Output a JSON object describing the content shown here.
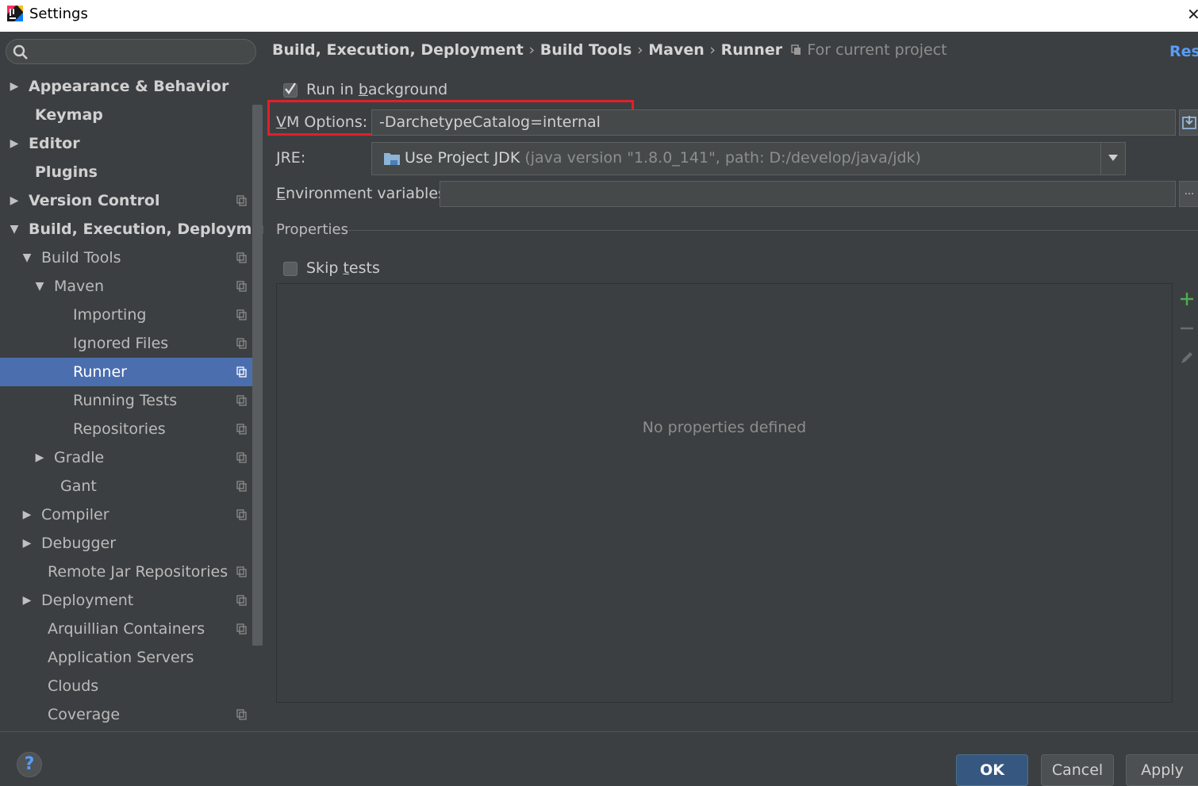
{
  "window": {
    "title": "Settings"
  },
  "search": {
    "placeholder": ""
  },
  "sidebar": {
    "items": [
      {
        "label": "Appearance & Behavior",
        "arrow": "▶",
        "bold": true
      },
      {
        "label": "Keymap",
        "arrow": "",
        "bold": true
      },
      {
        "label": "Editor",
        "arrow": "▶",
        "bold": true
      },
      {
        "label": "Plugins",
        "arrow": "",
        "bold": true
      },
      {
        "label": "Version Control",
        "arrow": "▶",
        "bold": true
      },
      {
        "label": "Build, Execution, Deployment",
        "arrow": "▼",
        "bold": true
      },
      {
        "label": "Build Tools",
        "arrow": "▼"
      },
      {
        "label": "Maven",
        "arrow": "▼"
      },
      {
        "label": "Importing",
        "arrow": ""
      },
      {
        "label": "Ignored Files",
        "arrow": ""
      },
      {
        "label": "Runner",
        "arrow": "",
        "selected": true
      },
      {
        "label": "Running Tests",
        "arrow": ""
      },
      {
        "label": "Repositories",
        "arrow": ""
      },
      {
        "label": "Gradle",
        "arrow": "▶"
      },
      {
        "label": "Gant",
        "arrow": ""
      },
      {
        "label": "Compiler",
        "arrow": "▶"
      },
      {
        "label": "Debugger",
        "arrow": "▶"
      },
      {
        "label": "Remote Jar Repositories",
        "arrow": ""
      },
      {
        "label": "Deployment",
        "arrow": "▶"
      },
      {
        "label": "Arquillian Containers",
        "arrow": ""
      },
      {
        "label": "Application Servers",
        "arrow": ""
      },
      {
        "label": "Clouds",
        "arrow": ""
      },
      {
        "label": "Coverage",
        "arrow": ""
      }
    ]
  },
  "breadcrumb": {
    "part1": "Build, Execution, Deployment",
    "part2": "Build Tools",
    "part3": "Maven",
    "part4": "Runner",
    "separator": "›",
    "scope": "For current project",
    "reset_label": "Reset"
  },
  "form": {
    "run_in_background": {
      "label_pre": "Run in ",
      "label_mnemonic": "b",
      "label_post": "ackground",
      "checked": true
    },
    "vm_options": {
      "label_mnemonic": "V",
      "label_post": "M Options:",
      "value": "-DarchetypeCatalog=internal"
    },
    "jre": {
      "label_mnemonic": "J",
      "label_post": "RE:",
      "selected_main": "Use Project JDK",
      "selected_detail": "(java version \"1.8.0_141\", path: D:/develop/java/jdk)"
    },
    "env_vars": {
      "label_mnemonic": "E",
      "label_post": "nvironment variables:",
      "value": "",
      "ellipsis": "..."
    },
    "properties": {
      "title": "Properties",
      "empty_text": "No properties defined"
    },
    "skip_tests": {
      "label_pre": "Skip ",
      "label_mnemonic": "t",
      "label_post": "ests",
      "checked": false
    }
  },
  "buttons": {
    "help": "?",
    "ok": "OK",
    "cancel": "Cancel",
    "apply": "Apply"
  },
  "colors": {
    "accent": "#4b6eaf",
    "highlight_box": "#e0202a",
    "link": "#589df6",
    "add": "#4caf50"
  }
}
